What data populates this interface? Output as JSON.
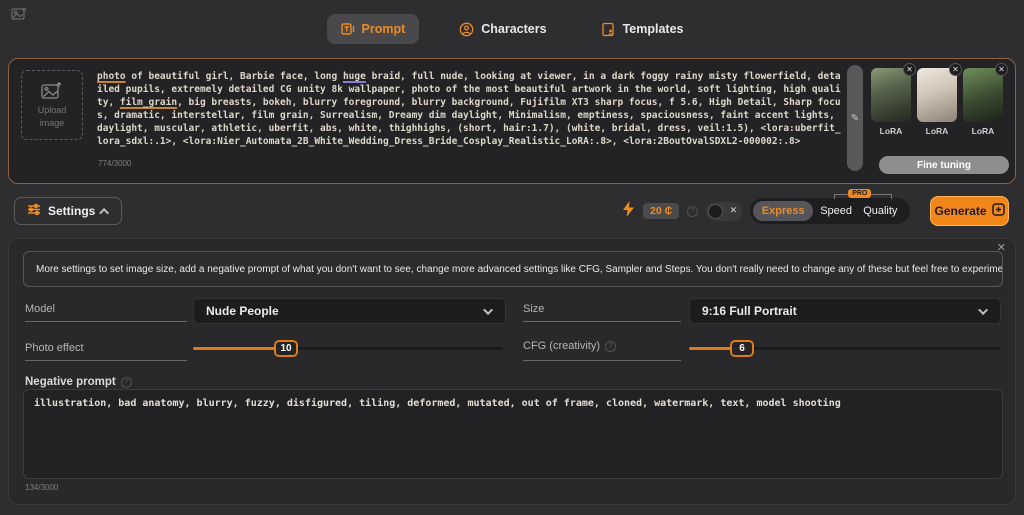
{
  "header": {
    "tabs": [
      {
        "label": "Prompt"
      },
      {
        "label": "Characters"
      },
      {
        "label": "Templates"
      }
    ]
  },
  "prompt_panel": {
    "upload_label_line1": "Upload",
    "upload_label_line2": "image",
    "char_counter": "774/3000",
    "segments": [
      {
        "t": "photo",
        "u": "orange"
      },
      {
        "t": " of beautiful girl, Barbie face, long "
      },
      {
        "t": "huge",
        "u": "purple"
      },
      {
        "t": " braid, full nude, looking at viewer, in a dark foggy rainy misty flowerfield, detailed pupils, extremely detailed CG unity 8k wallpaper, photo of the most beautiful artwork in the world, soft lighting, high quality, "
      },
      {
        "t": "film_grain",
        "u": "orange"
      },
      {
        "t": ", big breasts, bokeh, blurry foreground, blurry background, Fujifilm XT3 sharp focus, f 5.6, High Detail, Sharp focus, dramatic, interstellar, film grain, Surrealism, Dreamy dim daylight, Minimalism, emptiness, spaciousness, faint accent lights, daylight, muscular, athletic, uberfit, abs, white, thighhighs, (short, hair:1.7), (white, bridal, dress, veil:1.5), <lora:uberfit_lora_sdxl:.1>, <lora:Nier_Automata_2B_White_Wedding_Dress_Bride_Cosplay_Realistic_LoRA:.8>, <lora:2BoutOvalSDXL2-000002:.8>"
      }
    ],
    "lora": {
      "items": [
        {
          "label": "LoRA"
        },
        {
          "label": "LoRA"
        },
        {
          "label": "LoRA"
        }
      ],
      "fine_tuning_label": "Fine tuning"
    },
    "pencil_icon": "✎"
  },
  "toolbar": {
    "settings_label": "Settings",
    "credits": "20 ₵",
    "info_glyph": "?",
    "toggle_off_glyph": "✕",
    "modes": {
      "express": "Express",
      "speed": "Speed",
      "quality": "Quality",
      "pro_badge": "PRO"
    },
    "generate_label": "Generate"
  },
  "settings_panel": {
    "close_glyph": "✕",
    "description": "More settings to set image size, add a negative prompt of what you don't want to see, change more advanced settings like CFG, Sampler and Steps. You don't really need to change any of these but feel free to experiment.",
    "model": {
      "label": "Model",
      "value": "Nude People"
    },
    "size": {
      "label": "Size",
      "value": "9:16 Full Portrait"
    },
    "photo_effect": {
      "label": "Photo effect",
      "value": "10",
      "percent": 30
    },
    "cfg": {
      "label": "CFG (creativity)",
      "value": "6",
      "percent": 17,
      "info_glyph": "?"
    },
    "negative_prompt": {
      "label": "Negative prompt",
      "value": "illustration, bad anatomy, blurry, fuzzy, disfigured, tiling, deformed, mutated, out of frame, cloned, watermark, text, model shooting",
      "counter": "134/3000",
      "info_glyph": "?"
    }
  },
  "colors": {
    "accent_orange": "#ed8b23",
    "panel_border_orange": "#8f6140",
    "background": "#2e2e30",
    "underline_orange": "#c8862a",
    "underline_purple": "#8a7ae0"
  }
}
